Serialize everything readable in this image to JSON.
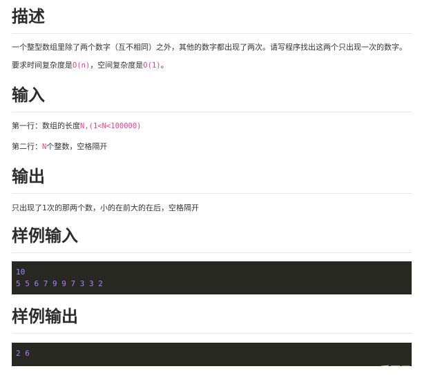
{
  "sections": {
    "desc": {
      "title": "描述",
      "p1": "一个整型数组里除了两个数字（互不相同）之外，其他的数字都出现了两次。请写程序找出这两个只出现一次的数字。",
      "p2_prefix": "要求时间复杂度是",
      "p2_code1": "O(n)",
      "p2_mid": "，空间复杂度是",
      "p2_code2": "O(1)",
      "p2_suffix": "。"
    },
    "input": {
      "title": "输入",
      "l1_prefix": "第一行：数组的长度",
      "l1_code": "N,(1<N<100000)",
      "l2_code": "N",
      "l2_suffix": "个整数，空格隔开",
      "l2_prefix": "第二行："
    },
    "output": {
      "title": "输出",
      "p1": "只出现了1次的那两个数，小的在前大的在后，空格隔开"
    },
    "sample_input": {
      "title": "样例输入",
      "line1": "10",
      "line2": "5 5 6 7 9 9 7 3 3 2"
    },
    "sample_output": {
      "title": "样例输出",
      "line1": "2 6"
    }
  },
  "watermark": "CSDN @爱雨天",
  "colors": {
    "inline_code": "#e83e8c",
    "code_bg": "#272822",
    "code_number": "#ae81ff"
  }
}
